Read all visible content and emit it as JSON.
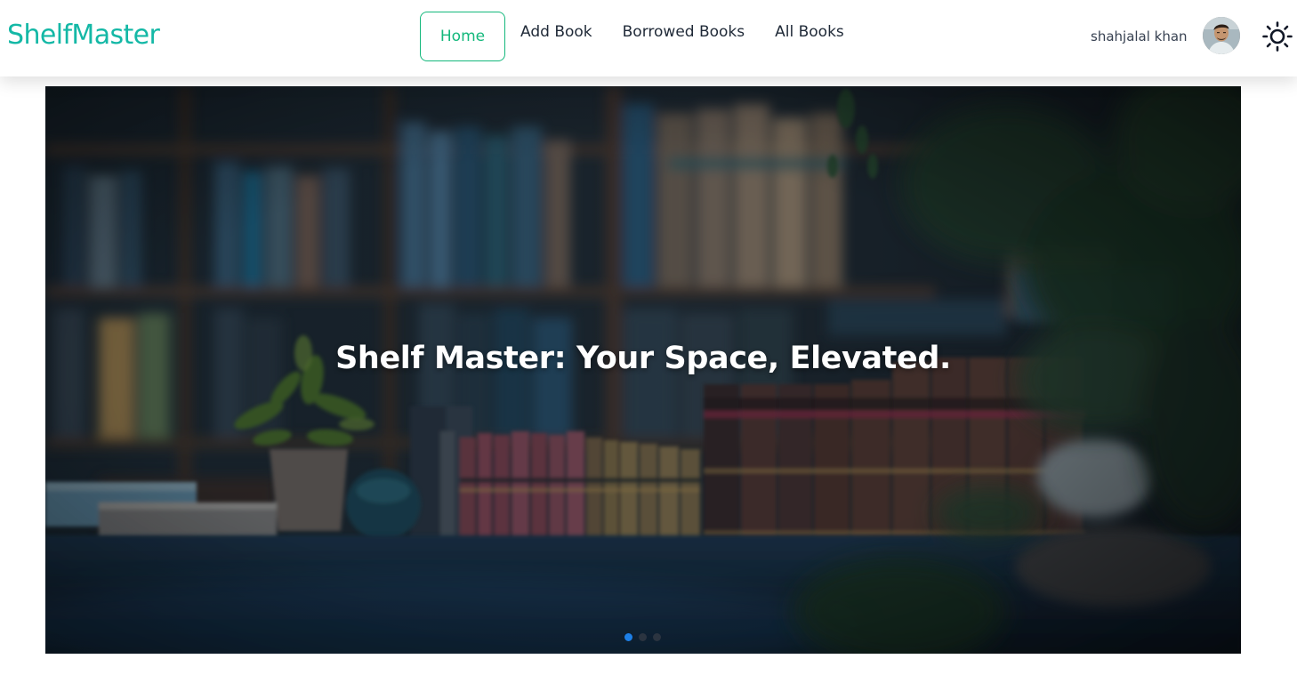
{
  "brand": {
    "name": "ShelfMaster",
    "color": "#14b8a6"
  },
  "nav": {
    "links": [
      {
        "label": "Home",
        "active": true
      },
      {
        "label": "Add Book",
        "active": false
      },
      {
        "label": "Borrowed Books",
        "active": false
      },
      {
        "label": "All Books",
        "active": false
      }
    ],
    "active_color": "#14b87c"
  },
  "user": {
    "name": "shahjalal khan",
    "avatar_icon": "user-avatar-photo",
    "theme_icon": "sun-icon"
  },
  "hero": {
    "title": "Shelf Master: Your Space, Elevated.",
    "background": "library-bookshelf-photo",
    "slides": {
      "count": 3,
      "active_index": 0
    },
    "dot_active_color": "#1d7fe6"
  }
}
